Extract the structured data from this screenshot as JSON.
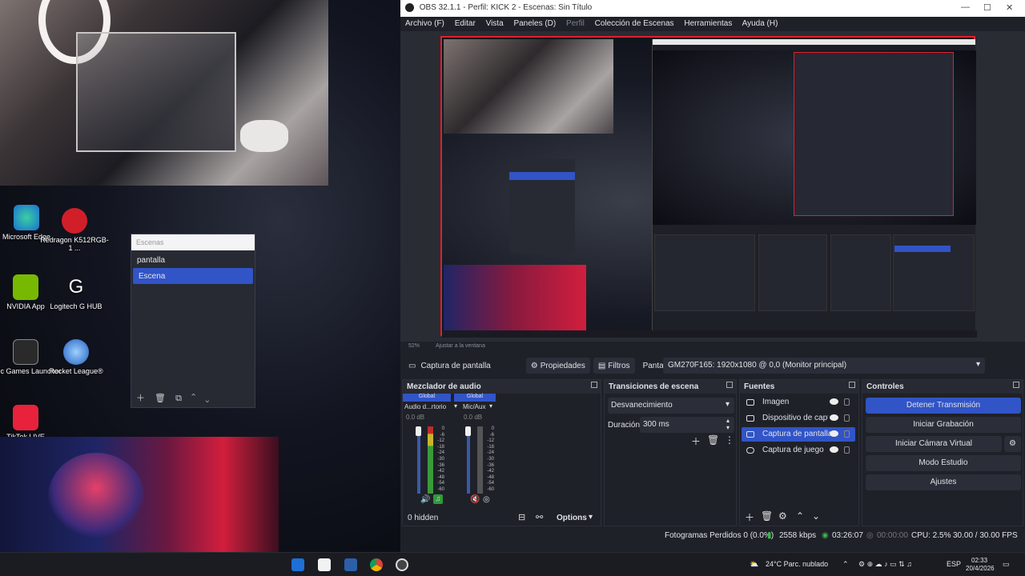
{
  "window": {
    "title": "OBS 32.1.1 - Perfil: KICK 2 - Escenas: Sin Título",
    "minimize": "—",
    "maximize": "☐",
    "close": "✕"
  },
  "menu": {
    "items": [
      "Archivo (F)",
      "Editar",
      "Vista",
      "Paneles (D)"
    ],
    "disabled": "Perfil",
    "items2": [
      "Colección de Escenas",
      "Herramientas",
      "Ayuda (H)"
    ]
  },
  "desktop": {
    "icons": [
      {
        "label": "Microsoft Edge"
      },
      {
        "label": "Redragon K512RGB-1 ..."
      },
      {
        "label": "NVIDIA App"
      },
      {
        "label": "Logitech G HUB"
      },
      {
        "label": "Epic Games Launcher"
      },
      {
        "label": "Rocket League®"
      },
      {
        "label": "TikTok LIVE"
      }
    ],
    "scenes_panel": {
      "header": "Escenas",
      "items": [
        "pantalla",
        "Escena"
      ],
      "footer": "＋ 🗑 ⧉ ⌃ ⌄"
    }
  },
  "preview": {
    "zoom": "52%",
    "fit": "Ajustar a la ventana"
  },
  "context": {
    "source": "Captura de pantalla",
    "properties": "Propiedades",
    "filters": "Filtros",
    "display_label": "Pantalla",
    "display_value": "GM270F165: 1920x1080 @ 0,0 (Monitor principal)"
  },
  "mixer": {
    "title": "Mezclador de audio",
    "tabs": [
      "Global",
      "Global"
    ],
    "channels": [
      {
        "name": "Audio d...rtorio",
        "db": "0.0 dB"
      },
      {
        "name": "Mic/Aux",
        "db": "0.0 dB"
      }
    ],
    "scale": [
      "0",
      "-6",
      "-12",
      "-18",
      "-24",
      "-30",
      "-36",
      "-42",
      "-48",
      "-54",
      "-60"
    ],
    "hidden": "0 hidden",
    "options": "Options"
  },
  "transitions": {
    "title": "Transiciones de escena",
    "type": "Desvanecimiento",
    "duration_label": "Duración",
    "duration_value": "300 ms"
  },
  "sources": {
    "title": "Fuentes",
    "items": [
      {
        "label": "Imagen",
        "icon": "image-icon"
      },
      {
        "label": "Dispositivo de captura",
        "icon": "camera-icon"
      },
      {
        "label": "Captura de pantalla",
        "icon": "monitor-icon"
      },
      {
        "label": "Captura de juego",
        "icon": "gamepad-icon"
      }
    ]
  },
  "controls": {
    "title": "Controles",
    "stop_stream": "Detener Transmisión",
    "start_recording": "Iniciar Grabación",
    "virtual_cam": "Iniciar Cámara Virtual",
    "studio_mode": "Modo Estudio",
    "settings": "Ajustes"
  },
  "status": {
    "dropped": "Fotogramas Perdidos 0 (0.0%)",
    "bitrate": "2558 kbps",
    "stream_time": "03:26:07",
    "rec_time": "00:00:00",
    "cpu": "CPU: 2.5%",
    "fps": "30.00 / 30.00 FPS"
  },
  "taskbar": {
    "weather": "24°C  Parc. nublado",
    "lang": "ESP",
    "time": "02:33",
    "date": "20/4/2026"
  },
  "colors": {
    "accent": "#3154c7",
    "selection_red": "#e0202d",
    "panel": "#1f2129"
  }
}
